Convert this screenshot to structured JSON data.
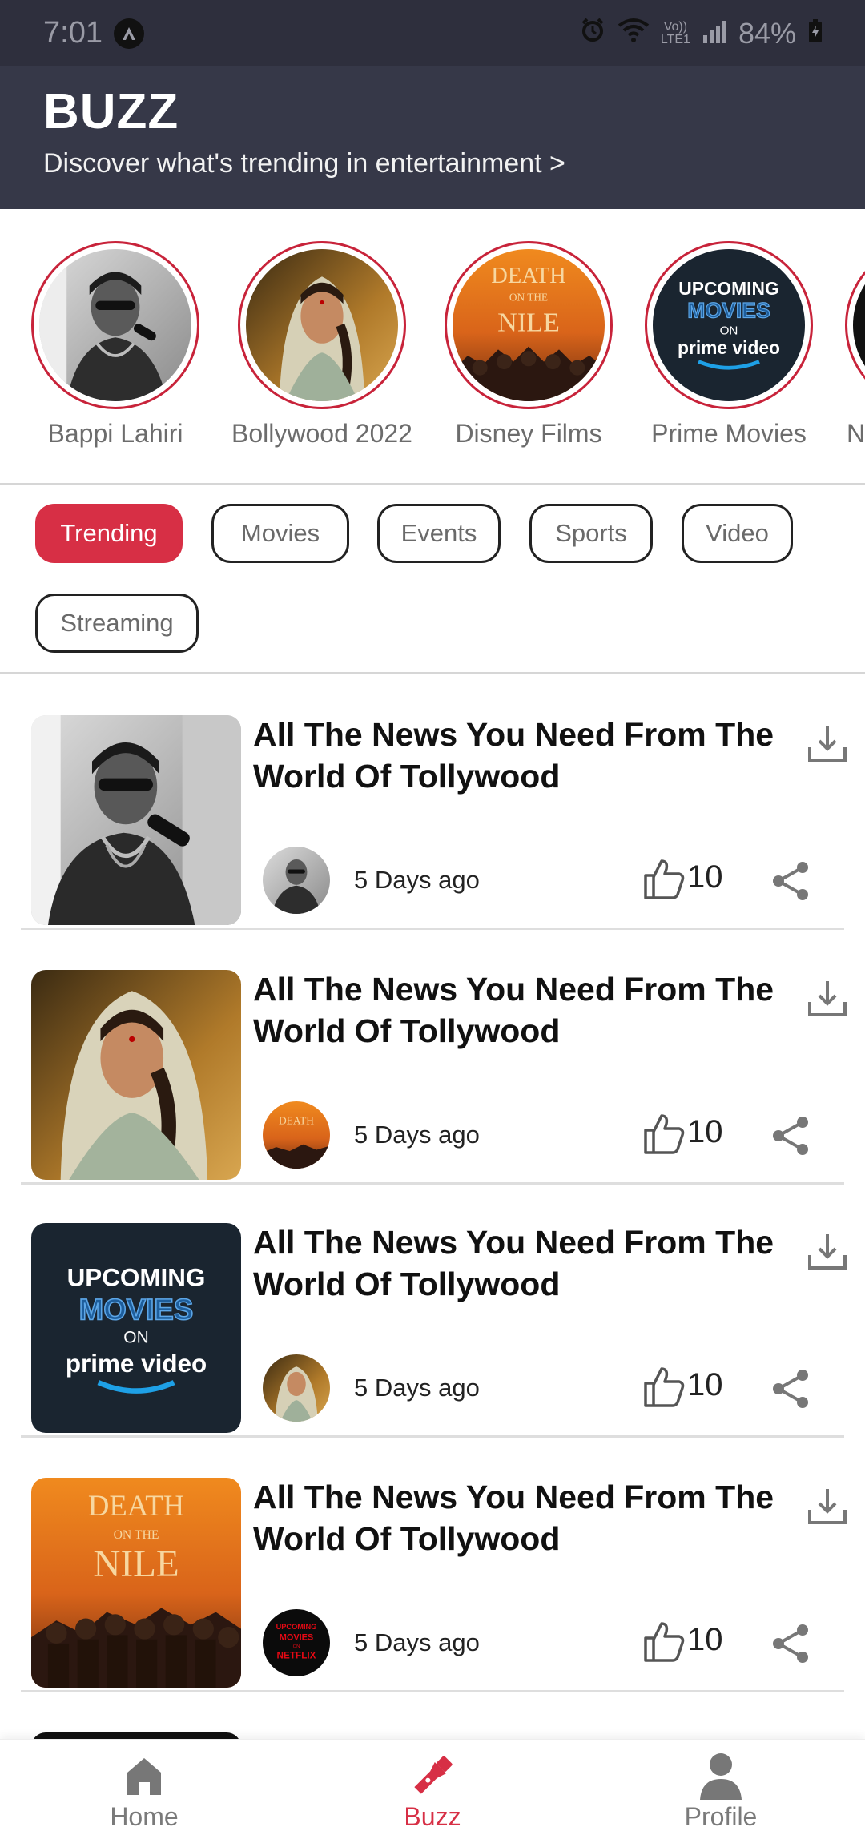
{
  "status_bar": {
    "time": "7:01",
    "battery": "84%",
    "network_top": "Vo))",
    "network_bottom": "LTE1"
  },
  "header": {
    "title": "BUZZ",
    "subtitle": "Discover what's trending in entertainment >"
  },
  "stories": [
    {
      "label": "Bappi Lahiri"
    },
    {
      "label": "Bollywood 2022"
    },
    {
      "label": "Disney Films"
    },
    {
      "label": "Prime Movies"
    },
    {
      "label": "N"
    }
  ],
  "art": {
    "death_line1": "DEATH",
    "death_line2": "ON THE",
    "death_line3": "NILE",
    "prime_line1": "UPCOMING",
    "prime_line2": "MOVIES",
    "prime_line3": "ON",
    "prime_line4": "prime video",
    "netflix_line1": "UPCOMING",
    "netflix_line2": "MOVIES",
    "netflix_line3": "ON",
    "netflix_line4": "NETFLIX"
  },
  "filters": [
    {
      "label": "Trending",
      "active": true
    },
    {
      "label": "Movies"
    },
    {
      "label": "Events"
    },
    {
      "label": "Sports"
    },
    {
      "label": "Video"
    },
    {
      "label": "Streaming"
    }
  ],
  "feed": [
    {
      "title": "All The News You Need From The World Of Tollywood",
      "time": "5 Days ago",
      "likes": "10"
    },
    {
      "title": "All The News You Need From The World Of Tollywood",
      "time": "5 Days ago",
      "likes": "10"
    },
    {
      "title": "All The News You Need From The World Of Tollywood",
      "time": "5 Days ago",
      "likes": "10"
    },
    {
      "title": "All The News You Need From The World Of Tollywood",
      "time": "5 Days ago",
      "likes": "10"
    }
  ],
  "bottom_nav": [
    {
      "label": "Home",
      "icon": "home-icon"
    },
    {
      "label": "Buzz",
      "icon": "flashlight-icon",
      "active": true
    },
    {
      "label": "Profile",
      "icon": "person-icon"
    }
  ],
  "colors": {
    "accent": "#d72f45",
    "header_bg": "#363848",
    "status_bg": "#2e2f3d"
  }
}
